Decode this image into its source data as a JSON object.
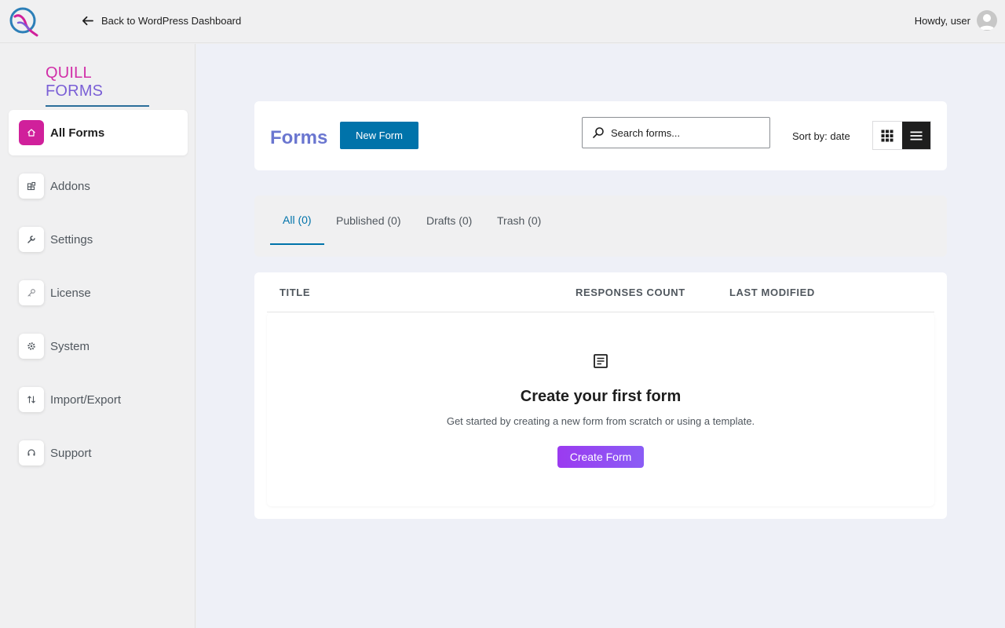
{
  "topbar": {
    "back_label": "Back to WordPress Dashboard",
    "howdy_label": "Howdy, user"
  },
  "sidebar": {
    "brand_part1": "QUILL",
    "brand_part2": "FORMS",
    "items": [
      {
        "label": "All Forms",
        "icon": "home-icon",
        "active": true
      },
      {
        "label": "Addons",
        "icon": "addons-icon"
      },
      {
        "label": "Settings",
        "icon": "wrench-icon"
      },
      {
        "label": "License",
        "icon": "key-icon"
      },
      {
        "label": "System",
        "icon": "gear-icon"
      },
      {
        "label": "Import/Export",
        "icon": "import-export-icon"
      },
      {
        "label": "Support",
        "icon": "headset-icon"
      }
    ]
  },
  "header": {
    "title": "Forms",
    "new_form_label": "New Form",
    "search_placeholder": "Search forms...",
    "sort_label": "Sort by: date"
  },
  "tabs": [
    {
      "label": "All (0)",
      "active": true
    },
    {
      "label": "Published (0)"
    },
    {
      "label": "Drafts (0)"
    },
    {
      "label": "Trash (0)"
    }
  ],
  "table": {
    "columns": [
      "TITLE",
      "RESPONSES COUNT",
      "LAST MODIFIED"
    ]
  },
  "empty_state": {
    "title": "Create your first form",
    "description": "Get started by creating a new form from scratch or using a template.",
    "button_label": "Create Form"
  },
  "colors": {
    "primary_blue": "#0073aa",
    "brand_pink": "#d0209b",
    "title_purple": "#6a76d0",
    "create_gradient_start": "#9b3bf0"
  }
}
